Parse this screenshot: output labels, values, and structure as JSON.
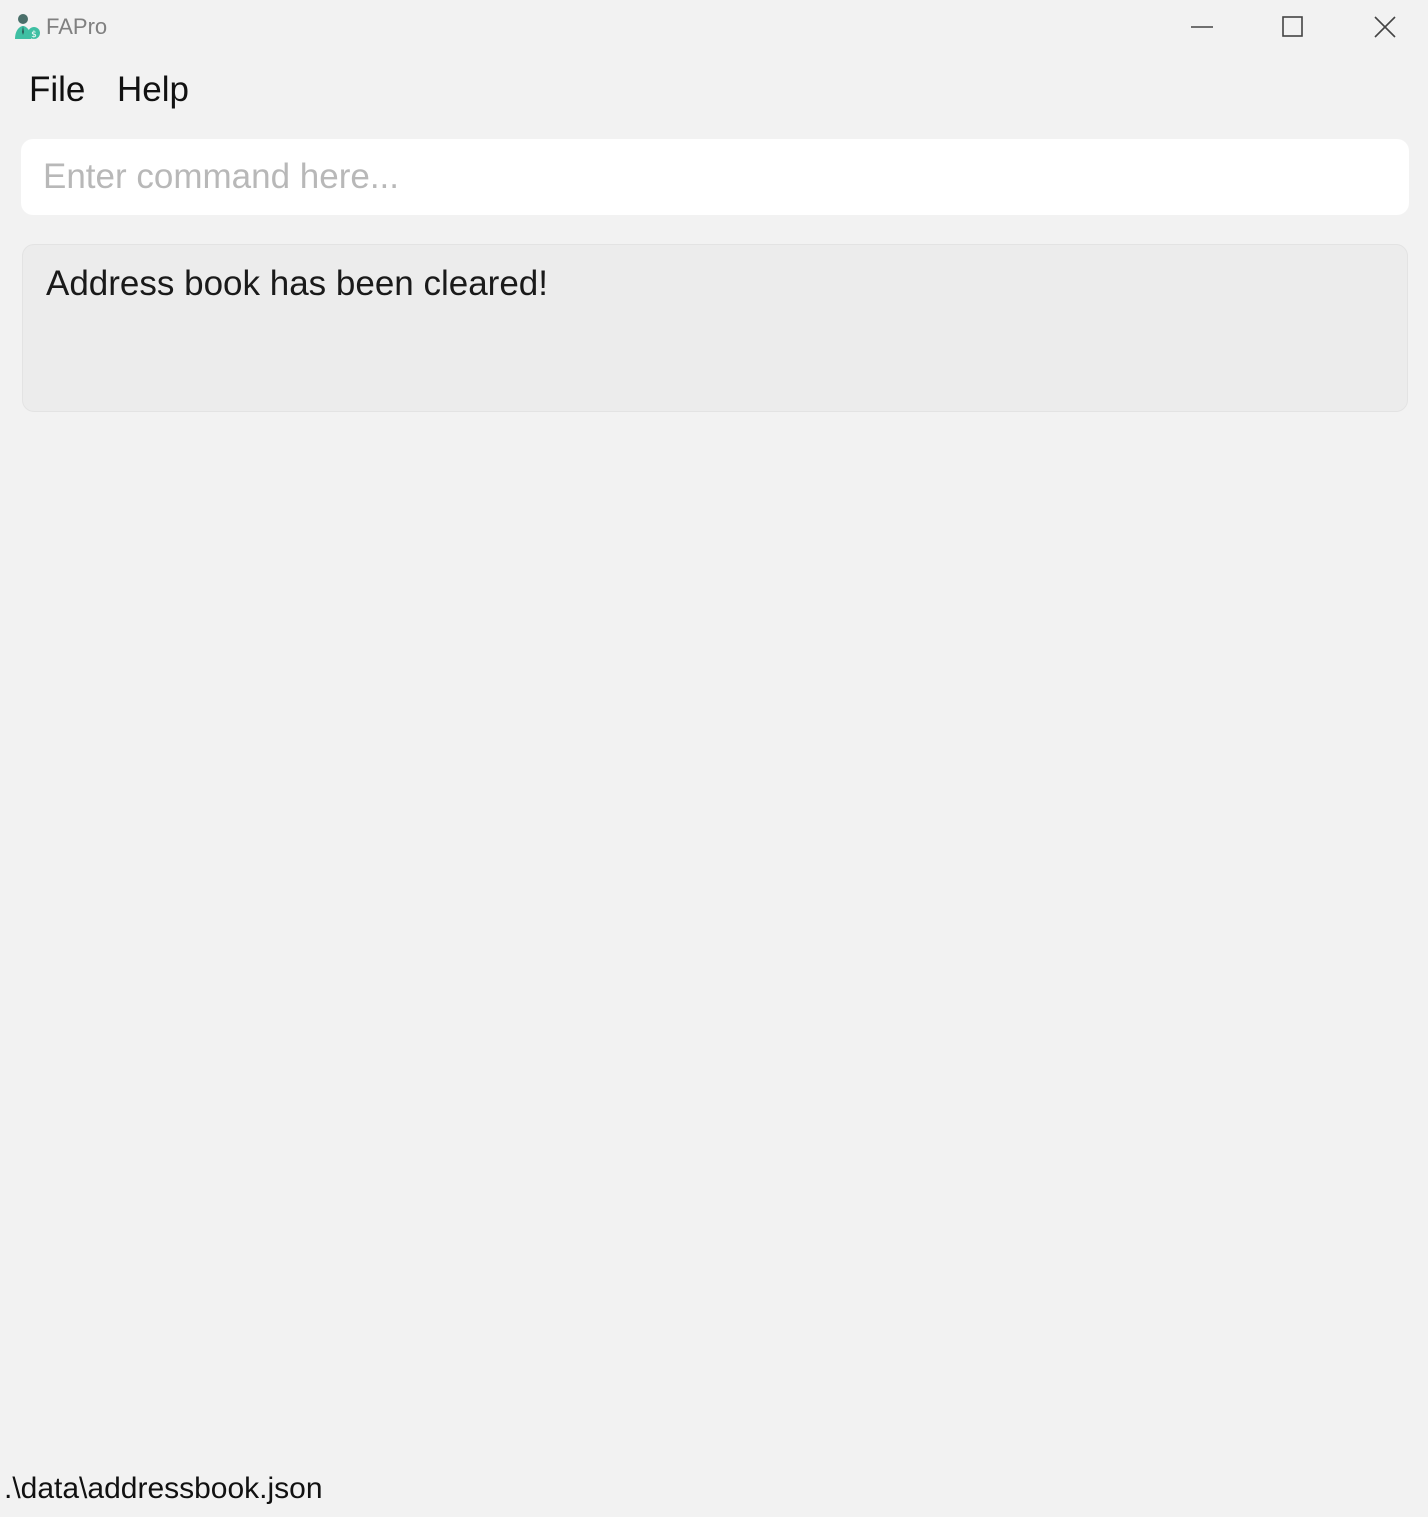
{
  "window": {
    "title": "FAPro",
    "icon": "app-logo-icon",
    "controls": [
      "minimize-icon",
      "maximize-icon",
      "close-icon"
    ]
  },
  "menu": {
    "items": [
      {
        "label": "File"
      },
      {
        "label": "Help"
      }
    ]
  },
  "command": {
    "value": "",
    "placeholder": "Enter command here..."
  },
  "result": {
    "message": "Address book has been cleared!"
  },
  "status": {
    "file_path": ".\\data\\addressbook.json"
  },
  "colors": {
    "background": "#f2f2f2",
    "input_background": "#ffffff",
    "result_background": "#ececec",
    "icon_accent": "#3fbfa3"
  }
}
